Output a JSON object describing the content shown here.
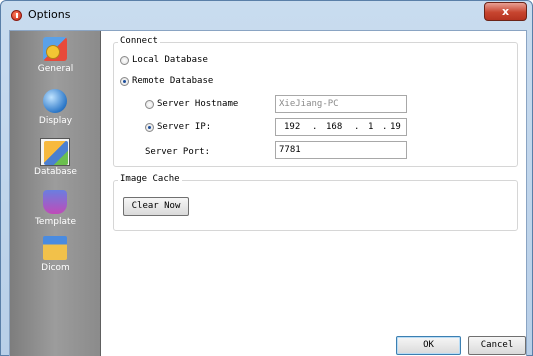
{
  "window": {
    "title": "Options",
    "close_label": "x"
  },
  "sidebar": {
    "items": [
      {
        "label": "General",
        "icon": "general-icon"
      },
      {
        "label": "Display",
        "icon": "display-icon"
      },
      {
        "label": "Database",
        "icon": "database-icon",
        "selected": true
      },
      {
        "label": "Template",
        "icon": "template-icon"
      },
      {
        "label": "Dicom",
        "icon": "dicom-icon"
      }
    ]
  },
  "connect": {
    "title": "Connect",
    "local_label": "Local Database",
    "remote_label": "Remote Database",
    "selected": "remote",
    "hostname_label": "Server Hostname",
    "hostname_value": "XieJiang-PC",
    "ip_label": "Server IP:",
    "ip_parts": [
      "192",
      "168",
      "1",
      "19"
    ],
    "ip_selected": true,
    "port_label": "Server Port:",
    "port_value": "7781"
  },
  "image_cache": {
    "title": "Image Cache",
    "clear_label": "Clear Now"
  },
  "footer": {
    "ok_label": "OK",
    "cancel_label": "Cancel"
  },
  "colors": {
    "sidebar": "#8b8b8b",
    "titlebar": "#c9dcef",
    "close": "#c7452f"
  }
}
